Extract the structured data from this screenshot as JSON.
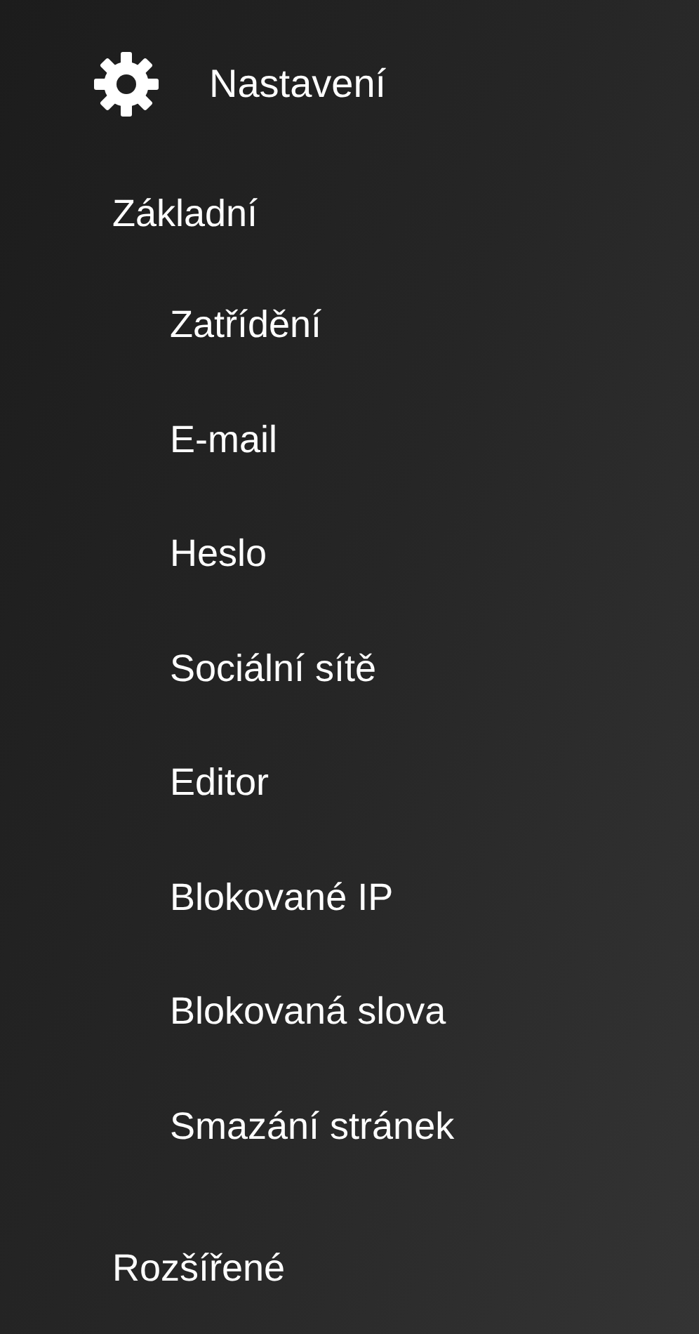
{
  "header": {
    "title": "Nastavení"
  },
  "sections": [
    {
      "label": "Základní",
      "children": [
        {
          "label": "Zatřídění"
        },
        {
          "label": "E-mail"
        },
        {
          "label": "Heslo"
        },
        {
          "label": "Sociální sítě"
        },
        {
          "label": "Editor"
        },
        {
          "label": "Blokované IP"
        },
        {
          "label": "Blokovaná slova"
        },
        {
          "label": "Smazání stránek"
        }
      ]
    },
    {
      "label": "Rozšířené"
    }
  ]
}
